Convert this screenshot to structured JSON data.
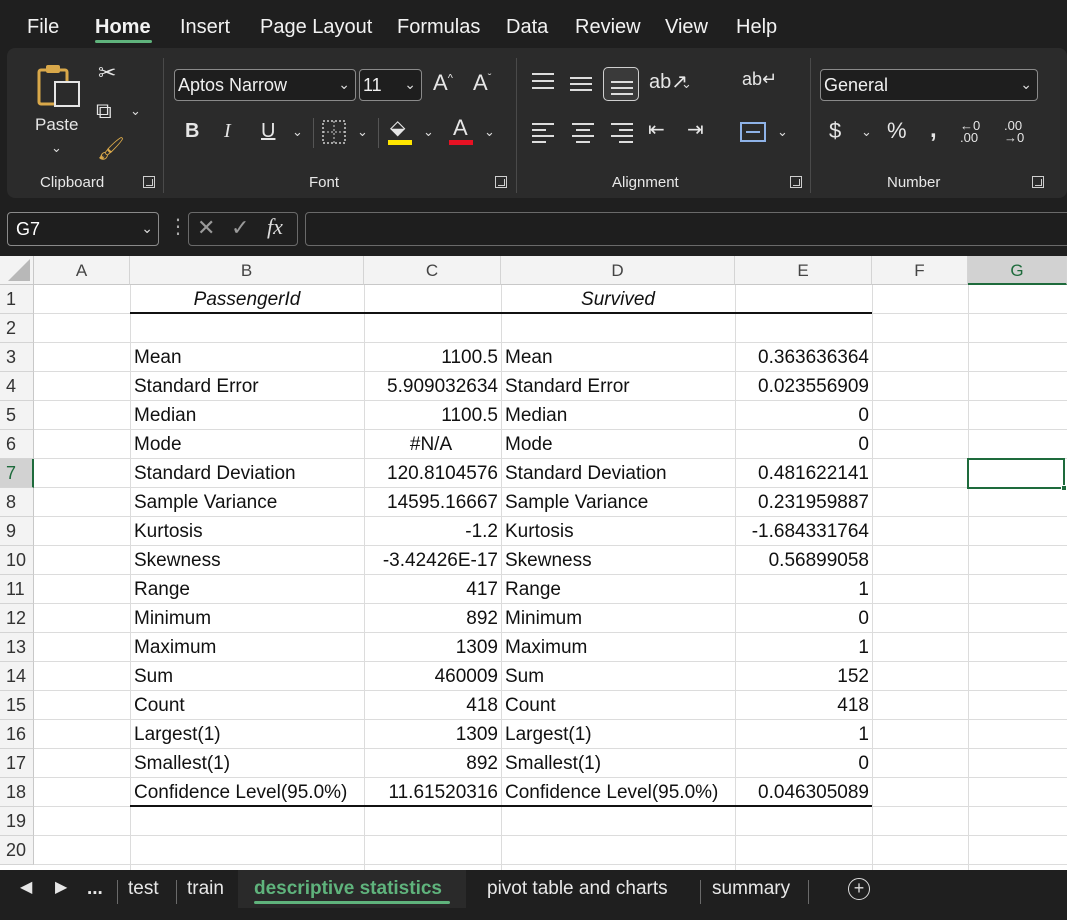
{
  "menu": {
    "tabs": [
      "File",
      "Home",
      "Insert",
      "Page Layout",
      "Formulas",
      "Data",
      "Review",
      "View",
      "Help"
    ],
    "active": "Home"
  },
  "ribbon": {
    "clipboard": {
      "label": "Clipboard",
      "paste": "Paste"
    },
    "font": {
      "label": "Font",
      "name": "Aptos Narrow",
      "size": "11"
    },
    "alignment": {
      "label": "Alignment"
    },
    "number": {
      "label": "Number",
      "format": "General"
    }
  },
  "formula_bar": {
    "name_box": "G7",
    "formula": ""
  },
  "columns": [
    "A",
    "B",
    "C",
    "D",
    "E",
    "F",
    "G"
  ],
  "selected_column": "G",
  "selected_row": 7,
  "rows": [
    "1",
    "2",
    "3",
    "4",
    "5",
    "6",
    "7",
    "8",
    "9",
    "10",
    "11",
    "12",
    "13",
    "14",
    "15",
    "16",
    "17",
    "18",
    "19",
    "20"
  ],
  "headers": {
    "b": "PassengerId",
    "d": "Survived"
  },
  "stats": [
    {
      "b": "Mean",
      "c": "1100.5",
      "d": "Mean",
      "e": "0.363636364"
    },
    {
      "b": "Standard Error",
      "c": "5.909032634",
      "d": "Standard Error",
      "e": "0.023556909"
    },
    {
      "b": "Median",
      "c": "1100.5",
      "d": "Median",
      "e": "0"
    },
    {
      "b": "Mode",
      "c": "#N/A",
      "d": "Mode",
      "e": "0"
    },
    {
      "b": "Standard Deviation",
      "c": "120.8104576",
      "d": "Standard Deviation",
      "e": "0.481622141"
    },
    {
      "b": "Sample Variance",
      "c": "14595.16667",
      "d": "Sample Variance",
      "e": "0.231959887"
    },
    {
      "b": "Kurtosis",
      "c": "-1.2",
      "d": "Kurtosis",
      "e": "-1.684331764"
    },
    {
      "b": "Skewness",
      "c": "-3.42426E-17",
      "d": "Skewness",
      "e": "0.56899058"
    },
    {
      "b": "Range",
      "c": "417",
      "d": "Range",
      "e": "1"
    },
    {
      "b": "Minimum",
      "c": "892",
      "d": "Minimum",
      "e": "0"
    },
    {
      "b": "Maximum",
      "c": "1309",
      "d": "Maximum",
      "e": "1"
    },
    {
      "b": "Sum",
      "c": "460009",
      "d": "Sum",
      "e": "152"
    },
    {
      "b": "Count",
      "c": "418",
      "d": "Count",
      "e": "418"
    },
    {
      "b": "Largest(1)",
      "c": "1309",
      "d": "Largest(1)",
      "e": "1"
    },
    {
      "b": "Smallest(1)",
      "c": "892",
      "d": "Smallest(1)",
      "e": "0"
    },
    {
      "b": "Confidence Level(95.0%)",
      "c": "11.61520316",
      "d": "Confidence Level(95.0%)",
      "e": "0.046305089"
    }
  ],
  "sheet_tabs": {
    "ellipsis": "...",
    "items": [
      "test",
      "train",
      "descriptive statistics",
      "pivot table and charts",
      "summary"
    ],
    "active": "descriptive statistics"
  },
  "colors": {
    "accent": "#1e6b3c",
    "tab_accent": "#5fb37c",
    "ribbon_bg": "#2b2b2b",
    "app_bg": "#1f1f1f"
  }
}
